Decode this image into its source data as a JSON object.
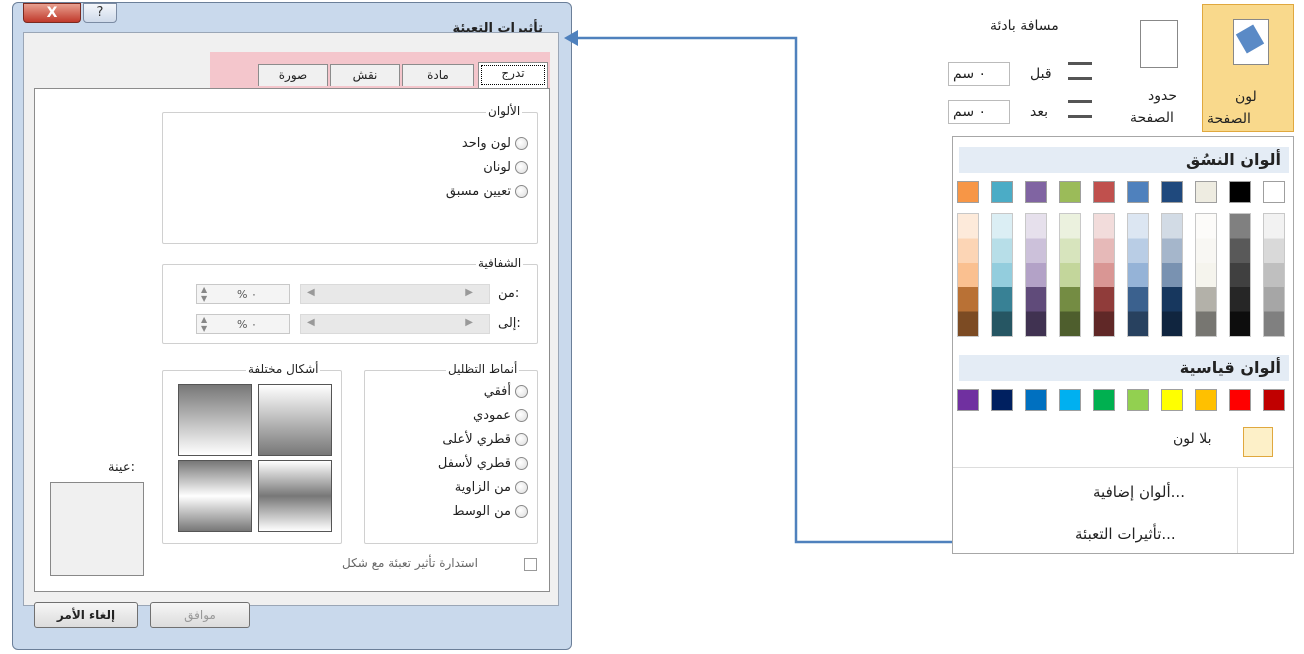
{
  "dialog": {
    "title": "تأثيرات التعبئة",
    "close": "X",
    "help": "?",
    "tabs": [
      "تدرج",
      "مادة",
      "نقش",
      "صورة"
    ],
    "colors_label": "الألوان",
    "opt_one": "لون واحد",
    "opt_two": "لونان",
    "opt_preset": "تعيين مسبق",
    "transparency_label": "الشفافية",
    "from": "من:",
    "to": "إلى:",
    "pct": "% ٠",
    "shading_label": "أنماط التظليل",
    "variants_label": "أشكال مختلفة",
    "s_horiz": "أفقي",
    "s_vert": "عمودي",
    "s_diagup": "قطري لأعلى",
    "s_diagdown": "قطري لأسفل",
    "s_corner": "من الزاوية",
    "s_center": "من الوسط",
    "sample": "عينة:",
    "rotate": "استدارة تأثير تعبئة مع شكل",
    "ok": "موافق",
    "cancel": "إلغاء الأمر"
  },
  "ribbon": {
    "spacing": "مسافة بادئة",
    "before": "قبل",
    "after": "بعد",
    "unit": "٠ سم",
    "borders": "حدود",
    "page": "الصفحة",
    "color_top": "لون",
    "color_bottom": "الصفحة"
  },
  "panel": {
    "theme_header": "ألوان النسُق",
    "std_header": "ألوان قياسية",
    "no_color": "بلا لون",
    "more": "ألوان إضافية...",
    "fill": "تأثيرات التعبئة...",
    "theme_colors": [
      "#ffffff",
      "#000000",
      "#eeece1",
      "#1f497d",
      "#4f81bd",
      "#c0504d",
      "#9bbb59",
      "#8064a2",
      "#4bacc6",
      "#f79646"
    ],
    "std_colors": [
      "#c00000",
      "#ff0000",
      "#ffc000",
      "#ffff00",
      "#92d050",
      "#00b050",
      "#00b0f0",
      "#0070c0",
      "#002060",
      "#7030a0"
    ]
  },
  "colors": {
    "arrow": "#4f81bd",
    "accent": "#f7c34e"
  }
}
